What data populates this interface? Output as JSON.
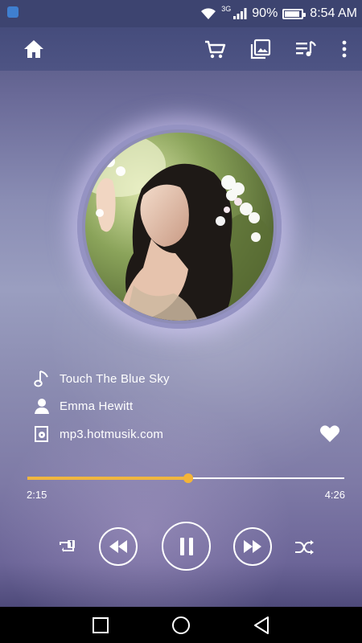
{
  "status_bar": {
    "network_type": "3G",
    "battery_text": "90%",
    "battery_level": 0.9,
    "time": "8:54 AM",
    "icons": [
      "app-notification-icon",
      "wifi-icon",
      "signal-icon",
      "battery-icon"
    ]
  },
  "toolbar": {
    "icons": [
      "home-icon",
      "cart-icon",
      "gallery-icon",
      "playlist-icon",
      "more-vert-icon"
    ]
  },
  "track": {
    "title": "Touch The Blue Sky",
    "artist": "Emma Hewitt",
    "source": "mp3.hotmusik.com",
    "favorite": true
  },
  "playback": {
    "elapsed": "2:15",
    "duration": "4:26",
    "progress_fraction": 0.5075,
    "state": "playing",
    "repeat_mode": "repeat-one",
    "shuffle": true
  },
  "colors": {
    "accent": "#f0b640",
    "status_bar": "#3d4470",
    "nav_bar": "#000000"
  }
}
